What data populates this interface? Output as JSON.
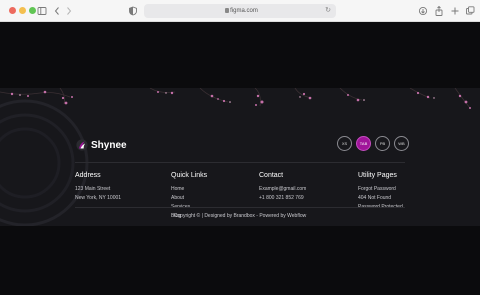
{
  "browser": {
    "url": "figma.com"
  },
  "brand": {
    "name": "Shynee"
  },
  "size_switcher": {
    "options": [
      "XS",
      "TAB",
      "PB",
      "WB"
    ],
    "active": "TAB",
    "accent_color": "#a0159a"
  },
  "columns": {
    "address": {
      "title": "Address",
      "lines": [
        "123 Main Street",
        "New York, NY 10001"
      ]
    },
    "quick_links": {
      "title": "Quick Links",
      "items": [
        "Home",
        "About",
        "Services",
        "Blog"
      ]
    },
    "contact": {
      "title": "Contact",
      "items": [
        "Example@gmail.com",
        "+1 800 321 852 769"
      ]
    },
    "utility": {
      "title": "Utility Pages",
      "items": [
        "Forgot Password",
        "404 Not Found",
        "Password Protected"
      ]
    }
  },
  "copyright": "Copyright © | Designed by Brandbox - Powered by Webflow"
}
